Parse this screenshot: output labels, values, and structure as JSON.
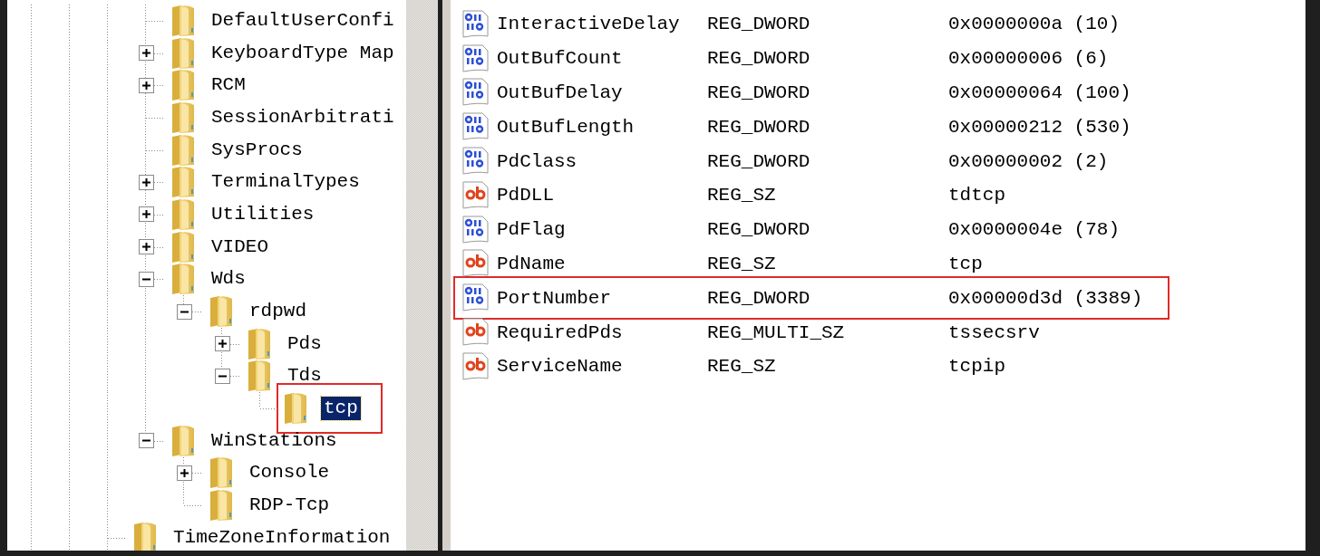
{
  "tree": {
    "continued_children": [
      {
        "label": "DefaultUserConfi",
        "expandable": false,
        "selected": false,
        "outlined": false
      },
      {
        "label": "KeyboardType Map",
        "expandable": true,
        "expanded": false,
        "selected": false,
        "outlined": false
      },
      {
        "label": "RCM",
        "expandable": true,
        "expanded": false,
        "selected": false,
        "outlined": false
      },
      {
        "label": "SessionArbitrati",
        "expandable": false,
        "selected": false,
        "outlined": false
      },
      {
        "label": "SysProcs",
        "expandable": false,
        "selected": false,
        "outlined": false
      },
      {
        "label": "TerminalTypes",
        "expandable": true,
        "expanded": false,
        "selected": false,
        "outlined": false
      },
      {
        "label": "Utilities",
        "expandable": true,
        "expanded": false,
        "selected": false,
        "outlined": false
      },
      {
        "label": "VIDEO",
        "expandable": true,
        "expanded": false,
        "selected": false,
        "outlined": false
      },
      {
        "label": "Wds",
        "expandable": true,
        "expanded": true,
        "selected": false,
        "outlined": false,
        "children": [
          {
            "label": "rdpwd",
            "expandable": true,
            "expanded": true,
            "selected": false,
            "outlined": false,
            "children": [
              {
                "label": "Pds",
                "expandable": true,
                "expanded": false,
                "selected": false,
                "outlined": false
              },
              {
                "label": "Tds",
                "expandable": true,
                "expanded": true,
                "selected": false,
                "outlined": false,
                "children": [
                  {
                    "label": "tcp",
                    "expandable": false,
                    "selected": true,
                    "outlined": true
                  }
                ]
              }
            ]
          }
        ]
      },
      {
        "label": "WinStations",
        "expandable": true,
        "expanded": true,
        "selected": false,
        "outlined": false,
        "children": [
          {
            "label": "Console",
            "expandable": true,
            "expanded": false,
            "selected": false,
            "outlined": false
          },
          {
            "label": "RDP-Tcp",
            "expandable": false,
            "selected": false,
            "outlined": false
          }
        ]
      }
    ],
    "items": [
      {
        "label": "TimeZoneInformation",
        "expandable": false,
        "selected": false,
        "outlined": false
      }
    ]
  },
  "values": {
    "rows": [
      {
        "kind": "dword",
        "name": "InteractiveDelay",
        "type": "REG_DWORD",
        "data": "0x0000000a (10)",
        "outlined": false
      },
      {
        "kind": "dword",
        "name": "OutBufCount",
        "type": "REG_DWORD",
        "data": "0x00000006 (6)",
        "outlined": false
      },
      {
        "kind": "dword",
        "name": "OutBufDelay",
        "type": "REG_DWORD",
        "data": "0x00000064 (100)",
        "outlined": false
      },
      {
        "kind": "dword",
        "name": "OutBufLength",
        "type": "REG_DWORD",
        "data": "0x00000212 (530)",
        "outlined": false
      },
      {
        "kind": "dword",
        "name": "PdClass",
        "type": "REG_DWORD",
        "data": "0x00000002 (2)",
        "outlined": false
      },
      {
        "kind": "sz",
        "name": "PdDLL",
        "type": "REG_SZ",
        "data": "tdtcp",
        "outlined": false
      },
      {
        "kind": "dword",
        "name": "PdFlag",
        "type": "REG_DWORD",
        "data": "0x0000004e (78)",
        "outlined": false
      },
      {
        "kind": "sz",
        "name": "PdName",
        "type": "REG_SZ",
        "data": "tcp",
        "outlined": false
      },
      {
        "kind": "dword",
        "name": "PortNumber",
        "type": "REG_DWORD",
        "data": "0x00000d3d (3389)",
        "outlined": true
      },
      {
        "kind": "sz",
        "name": "RequiredPds",
        "type": "REG_MULTI_SZ",
        "data": "tssecsrv",
        "outlined": false
      },
      {
        "kind": "sz",
        "name": "ServiceName",
        "type": "REG_SZ",
        "data": "tcpip",
        "outlined": false
      }
    ]
  }
}
